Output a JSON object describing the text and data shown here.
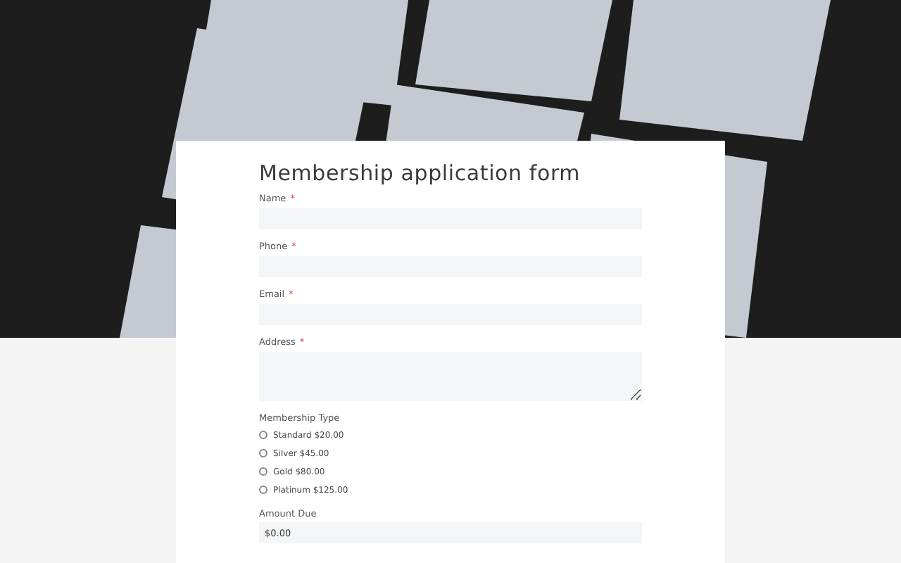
{
  "form": {
    "title": "Membership application form",
    "fields": [
      {
        "kind": "text",
        "label": "Name",
        "required_mark": "*"
      },
      {
        "kind": "text",
        "label": "Phone",
        "required_mark": "*"
      },
      {
        "kind": "text",
        "label": "Email",
        "required_mark": "*"
      },
      {
        "kind": "textarea",
        "label": "Address",
        "required_mark": "*"
      }
    ],
    "membership_type": {
      "label": "Membership Type",
      "options": [
        {
          "label": "Standard $20.00",
          "selected": false
        },
        {
          "label": "Silver $45.00",
          "selected": false
        },
        {
          "label": "Gold $80.00",
          "selected": false
        },
        {
          "label": "Platinum $125.00",
          "selected": false
        }
      ]
    },
    "amount_due": {
      "label": "Amount Due",
      "value": "$0.00"
    }
  }
}
